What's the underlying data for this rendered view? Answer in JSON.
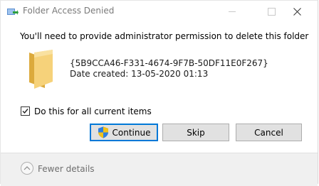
{
  "window": {
    "title": "Folder Access Denied",
    "icons": {
      "app": "folder-move-icon",
      "minimize": "minimize-icon",
      "maximize": "maximize-icon",
      "close": "close-icon"
    }
  },
  "dialog": {
    "message": "You'll need to provide administrator permission to delete this folder",
    "item": {
      "icon": "folder-icon",
      "name": "{5B9CCA46-F331-4674-9F7B-50DF11E0F267}",
      "date_created": "Date created: 13-05-2020 01:13"
    },
    "checkbox": {
      "label": "Do this for all current items",
      "checked": true
    },
    "buttons": {
      "continue": "Continue",
      "continue_icon": "uac-shield-icon",
      "skip": "Skip",
      "cancel": "Cancel"
    }
  },
  "footer": {
    "fewer_details": "Fewer details",
    "icon": "chevron-up-icon"
  }
}
